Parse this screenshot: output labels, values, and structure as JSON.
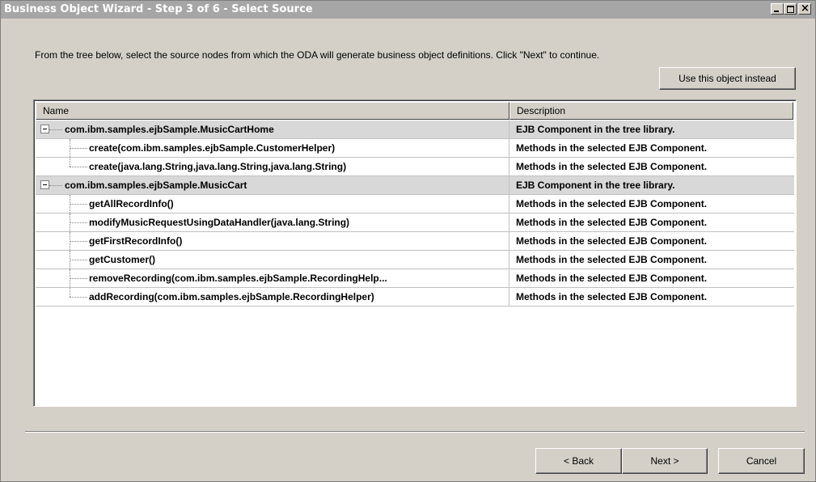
{
  "window": {
    "title": "Business Object Wizard - Step 3 of 6 - Select Source",
    "controls": {
      "close_label": "×"
    }
  },
  "instructions": "From the tree below, select the source nodes from which the ODA will generate business object definitions. Click \"Next\" to continue.",
  "use_object_button": "Use this object instead",
  "tree": {
    "columns": {
      "name": "Name",
      "description": "Description"
    },
    "rows": [
      {
        "type": "group",
        "name": "com.ibm.samples.ejbSample.MusicCartHome",
        "description": "EJB Component in the tree library."
      },
      {
        "type": "child",
        "name": "create(com.ibm.samples.ejbSample.CustomerHelper)",
        "description": "Methods in the selected EJB Component."
      },
      {
        "type": "child",
        "name": "create(java.lang.String,java.lang.String,java.lang.String)",
        "description": "Methods in the selected EJB Component."
      },
      {
        "type": "group",
        "name": "com.ibm.samples.ejbSample.MusicCart",
        "description": "EJB Component in the tree library."
      },
      {
        "type": "child",
        "name": "getAllRecordInfo()",
        "description": "Methods in the selected EJB Component."
      },
      {
        "type": "child",
        "name": "modifyMusicRequestUsingDataHandler(java.lang.String)",
        "description": "Methods in the selected EJB Component."
      },
      {
        "type": "child",
        "name": "getFirstRecordInfo()",
        "description": "Methods in the selected EJB Component."
      },
      {
        "type": "child",
        "name": "getCustomer()",
        "description": "Methods in the selected EJB Component."
      },
      {
        "type": "child",
        "name": "removeRecording(com.ibm.samples.ejbSample.RecordingHelp...",
        "description": "Methods in the selected EJB Component."
      },
      {
        "type": "child",
        "name": "addRecording(com.ibm.samples.ejbSample.RecordingHelper)",
        "description": "Methods in the selected EJB Component."
      }
    ]
  },
  "footer": {
    "back": "< Back",
    "next": "Next >",
    "cancel": "Cancel"
  }
}
